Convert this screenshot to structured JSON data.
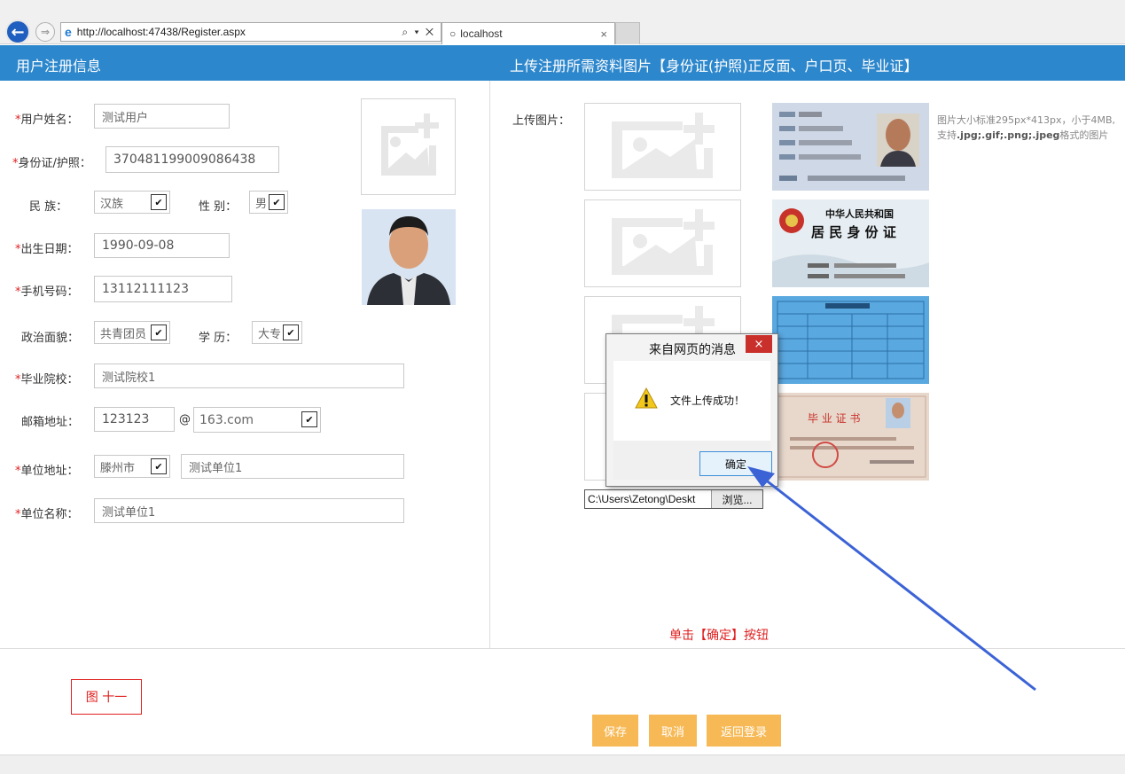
{
  "browser": {
    "url": "http://localhost:47438/Register.aspx",
    "url_tools": "⌕ ▾ ✕",
    "tab_title": "localhost",
    "tab_close": "×"
  },
  "header": {
    "left_title": "用户注册信息",
    "right_title": "上传注册所需资料图片【身份证(护照)正反面、户口页、毕业证】"
  },
  "form": {
    "name_label": "用户姓名：",
    "name_value": "测试用户",
    "id_label": "身份证/护照：",
    "id_value": "370481199009086438",
    "ethnicity_label": "民 族：",
    "ethnicity_value": "汉族",
    "gender_label": "性 别：",
    "gender_value": "男",
    "birth_label": "出生日期：",
    "birth_value": "1990-09-08",
    "phone_label": "手机号码：",
    "phone_value": "13112111123",
    "politics_label": "政治面貌：",
    "politics_value": "共青团员",
    "education_label": "学 历：",
    "education_value": "大专",
    "school_label": "毕业院校：",
    "school_value": "测试院校1",
    "email_label": "邮箱地址：",
    "email_user": "123123",
    "email_at": "@",
    "email_domain": "163.com",
    "address_label": "单位地址：",
    "address_city": "滕州市",
    "address_value": "测试单位1",
    "unit_label": "单位名称：",
    "unit_value": "测试单位1"
  },
  "upload": {
    "label": "上传图片：",
    "hint_line1": "图片大小标准295px*413px，小于4MB,",
    "hint_prefix": "支持",
    "hint_formats": ".jpg;.gif;.png;.jpeg",
    "hint_suffix": "格式的图片",
    "file_path": "C:\\Users\\Zetong\\Deskt",
    "browse_label": "浏览...",
    "idcard_back_line1": "中华人民共和国",
    "idcard_back_line2": "居 民 身 份 证",
    "diploma_title": "毕 业 证 书"
  },
  "instruction": "单击【确定】按钮",
  "figure_label": "图 十一",
  "buttons": {
    "save": "保存",
    "cancel": "取消",
    "back_login": "返回登录"
  },
  "dialog": {
    "title": "来自网页的消息",
    "message": "文件上传成功！",
    "ok": "确定",
    "close": "×"
  },
  "colors": {
    "header_blue": "#2d87cc",
    "button_orange": "#f7b955",
    "required_red": "#e02020",
    "arrow_blue": "#3b63d6"
  }
}
